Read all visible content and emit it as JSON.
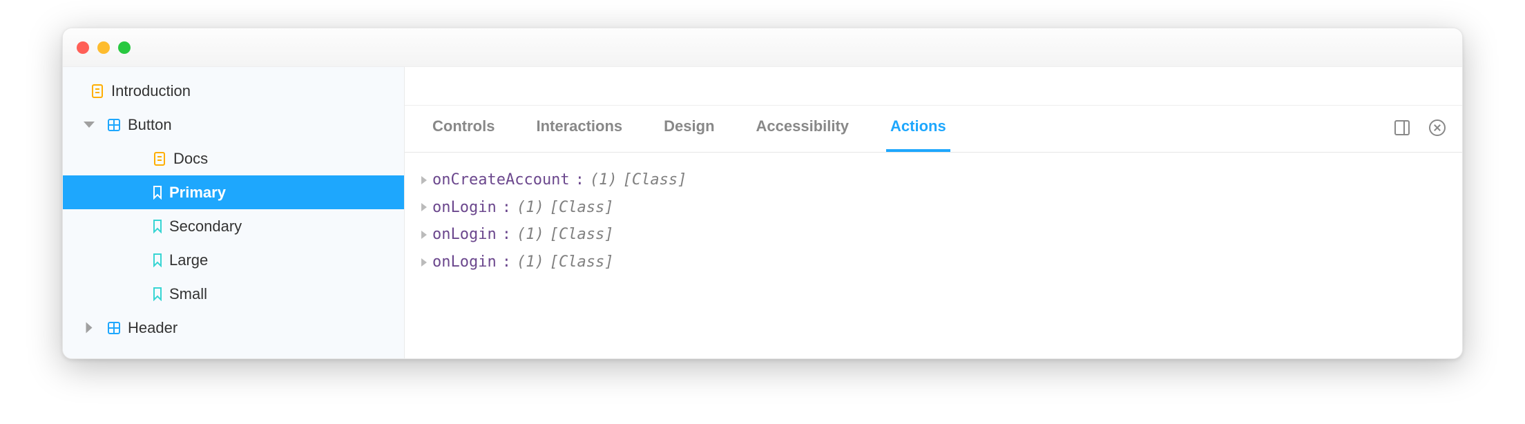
{
  "sidebar": {
    "items": [
      {
        "label": "Introduction",
        "type": "doc",
        "indent": 0
      },
      {
        "label": "Button",
        "type": "component",
        "indent": 1,
        "expanded": true
      },
      {
        "label": "Docs",
        "type": "doc",
        "indent": 2
      },
      {
        "label": "Primary",
        "type": "story",
        "indent": 2,
        "selected": true
      },
      {
        "label": "Secondary",
        "type": "story",
        "indent": 2
      },
      {
        "label": "Large",
        "type": "story",
        "indent": 2
      },
      {
        "label": "Small",
        "type": "story",
        "indent": 2
      },
      {
        "label": "Header",
        "type": "component",
        "indent": 1,
        "expanded": false
      }
    ]
  },
  "tabs": [
    {
      "label": "Controls"
    },
    {
      "label": "Interactions"
    },
    {
      "label": "Design"
    },
    {
      "label": "Accessibility"
    },
    {
      "label": "Actions",
      "active": true
    }
  ],
  "actions": {
    "log": [
      {
        "name": "onCreateAccount",
        "count": "(1)",
        "detail": "[Class]"
      },
      {
        "name": "onLogin",
        "count": "(1)",
        "detail": "[Class]"
      },
      {
        "name": "onLogin",
        "count": "(1)",
        "detail": "[Class]"
      },
      {
        "name": "onLogin",
        "count": "(1)",
        "detail": "[Class]"
      }
    ]
  }
}
